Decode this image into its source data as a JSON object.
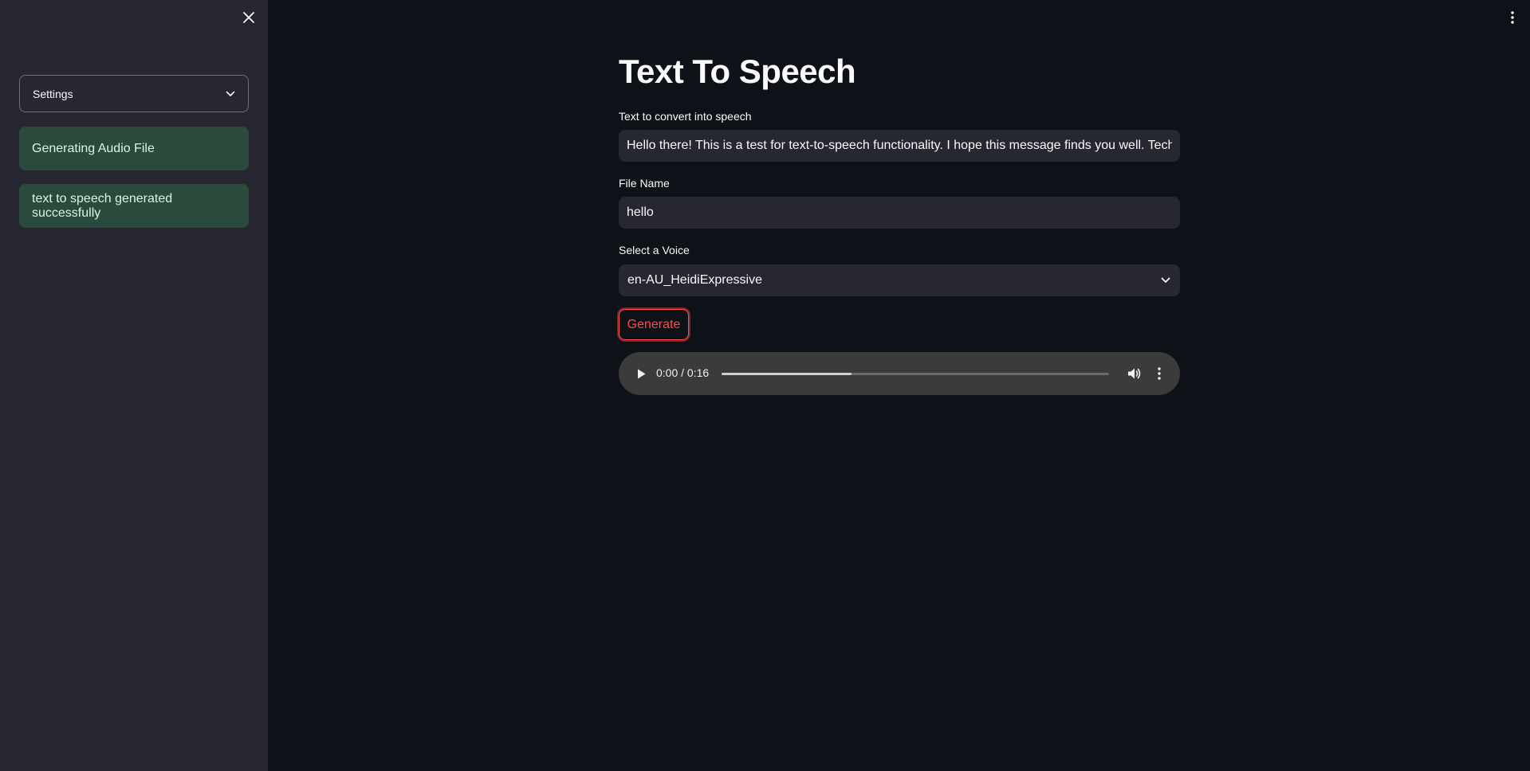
{
  "sidebar": {
    "close_icon": "close-icon",
    "expander": {
      "label": "Settings",
      "icon": "chevron-down-icon"
    },
    "alerts": [
      {
        "text": "Generating Audio File"
      },
      {
        "text": "text to speech generated successfully"
      }
    ],
    "alert_color": "#2a4a3b"
  },
  "header": {
    "menu_icon": "more-vertical-icon"
  },
  "main": {
    "title": "Text To Speech",
    "text_field": {
      "label": "Text to convert into speech",
      "value": "Hello there! This is a test for text-to-speech functionality. I hope this message finds you well. Technology"
    },
    "file_field": {
      "label": "File Name",
      "value": "hello"
    },
    "voice_select": {
      "label": "Select a Voice",
      "value": "en-AU_HeidiExpressive",
      "icon": "chevron-down-icon"
    },
    "generate_button": {
      "label": "Generate",
      "color": "#ff4b4b"
    },
    "audio": {
      "time": "0:00 / 0:16",
      "buffered_fraction": 0.335,
      "play_icon": "play-icon",
      "volume_icon": "volume-icon",
      "menu_icon": "more-vertical-icon"
    }
  },
  "colors": {
    "background": "#0e1117",
    "sidebar": "#262730",
    "accent": "#ff4b4b"
  }
}
